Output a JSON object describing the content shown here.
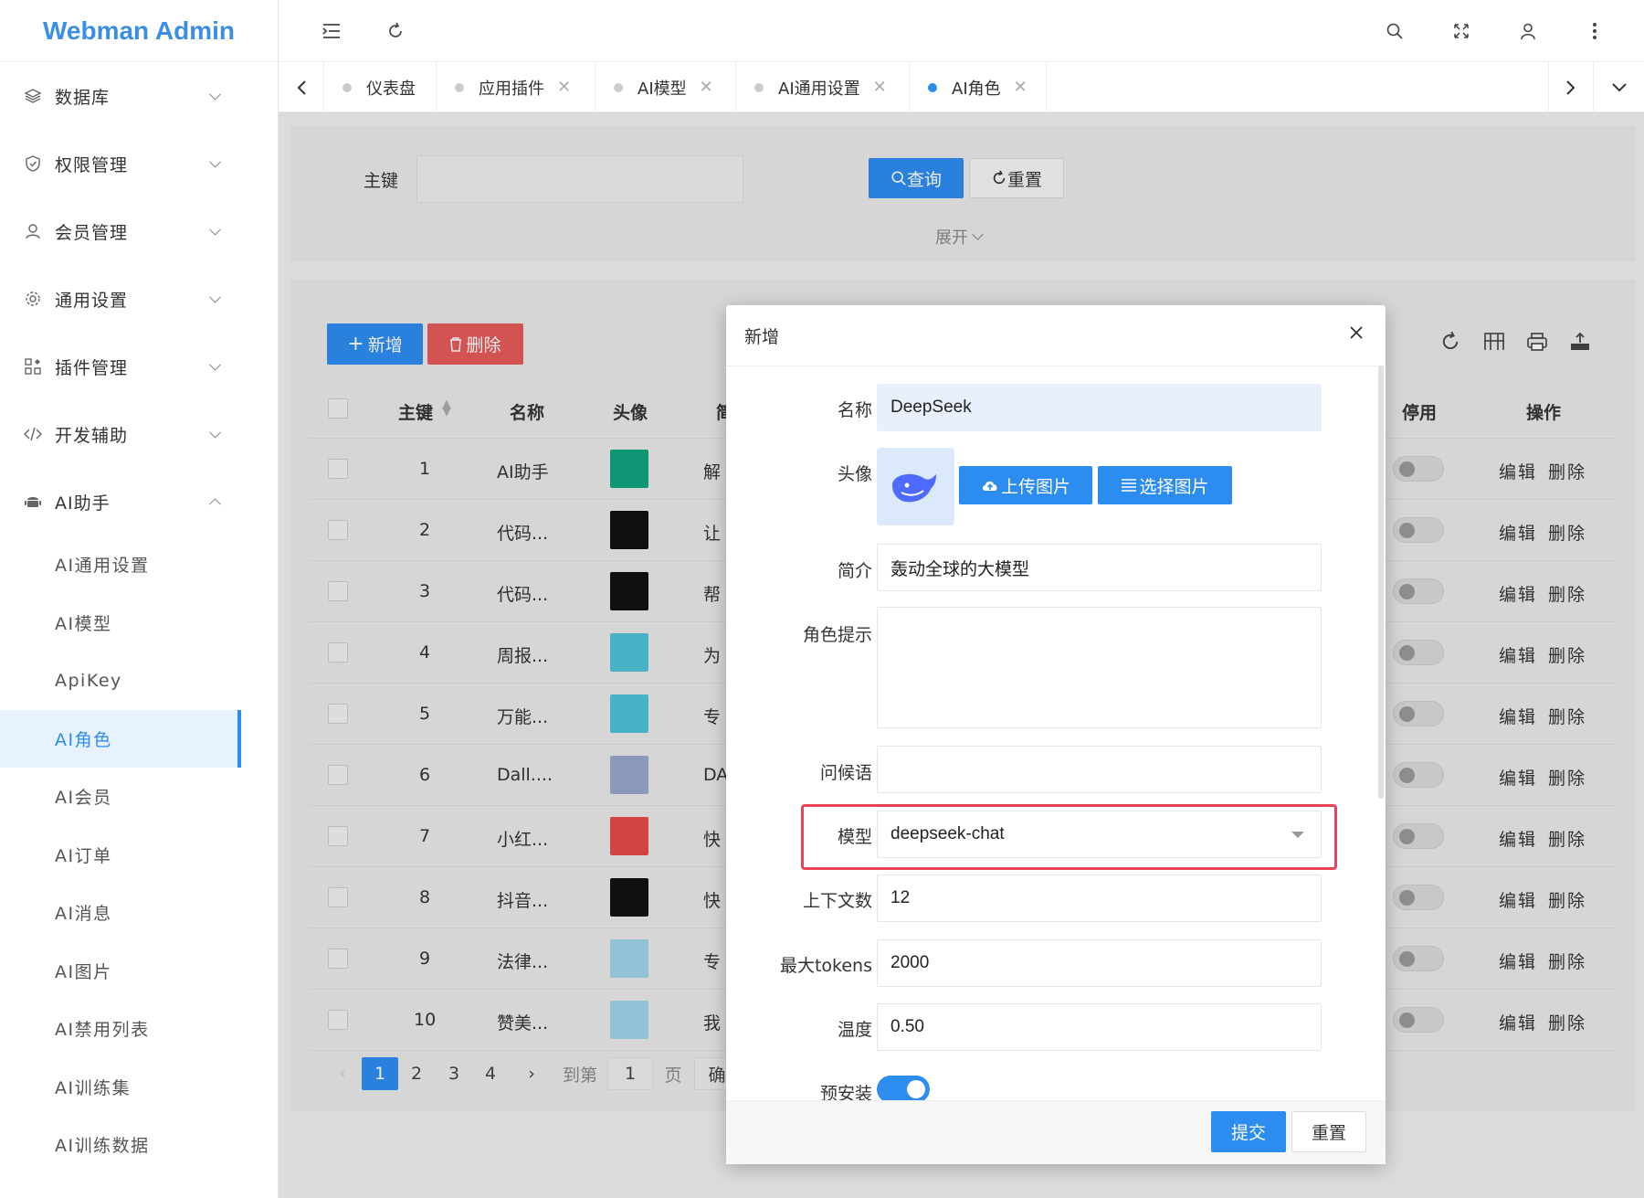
{
  "app": {
    "title": "Webman Admin"
  },
  "sidebar": {
    "groups": [
      {
        "label": "数据库",
        "icon": "layers-icon"
      },
      {
        "label": "权限管理",
        "icon": "shield-icon"
      },
      {
        "label": "会员管理",
        "icon": "user-icon"
      },
      {
        "label": "通用设置",
        "icon": "gear-icon"
      },
      {
        "label": "插件管理",
        "icon": "apps-icon"
      },
      {
        "label": "开发辅助",
        "icon": "code-icon"
      },
      {
        "label": "AI助手",
        "icon": "android-icon"
      }
    ],
    "subitems": [
      "AI通用设置",
      "AI模型",
      "ApiKey",
      "AI角色",
      "AI会员",
      "AI订单",
      "AI消息",
      "AI图片",
      "AI禁用列表",
      "AI训练集",
      "AI训练数据"
    ],
    "active": "AI角色"
  },
  "header": {
    "icons": [
      "menu-fold-icon",
      "refresh-icon",
      "search-icon",
      "fullscreen-icon",
      "user-icon",
      "more-icon"
    ]
  },
  "tabs": [
    {
      "label": "仪表盘",
      "closable": false
    },
    {
      "label": "应用插件",
      "closable": true
    },
    {
      "label": "AI模型",
      "closable": true
    },
    {
      "label": "AI通用设置",
      "closable": true
    },
    {
      "label": "AI角色",
      "closable": true,
      "active": true
    }
  ],
  "search": {
    "field_label": "主键",
    "field_value": "",
    "query_label": "查询",
    "reset_label": "重置",
    "expand_label": "展开"
  },
  "toolbar": {
    "add_label": "新增",
    "delete_label": "删除"
  },
  "table": {
    "columns": [
      "主键",
      "名称",
      "头像",
      "简",
      "停用",
      "操作"
    ],
    "rows": [
      {
        "id": "1",
        "name": "AI助手",
        "desc": "解",
        "avatar_color": "#10a37f",
        "avatar_icon": "openai-icon"
      },
      {
        "id": "2",
        "name": "代码...",
        "desc": "让",
        "avatar_color": "#111111",
        "avatar_icon": "terminal-icon"
      },
      {
        "id": "3",
        "name": "代码...",
        "desc": "帮",
        "avatar_color": "#111111",
        "avatar_icon": "code-icon"
      },
      {
        "id": "4",
        "name": "周报...",
        "desc": "为",
        "avatar_color": "#4fc3d8",
        "avatar_icon": "calendar-icon"
      },
      {
        "id": "5",
        "name": "万能...",
        "desc": "专",
        "avatar_color": "#4fc3d8",
        "avatar_icon": "translate-icon"
      },
      {
        "id": "6",
        "name": "Dall....",
        "desc": "DA",
        "avatar_color": "#9aa6c8",
        "avatar_icon": "palette-icon"
      },
      {
        "id": "7",
        "name": "小红...",
        "desc": "快",
        "avatar_color": "#e84a4a",
        "avatar_icon": "xiaohongshu-icon"
      },
      {
        "id": "8",
        "name": "抖音...",
        "desc": "快",
        "avatar_color": "#111111",
        "avatar_icon": "tiktok-icon"
      },
      {
        "id": "9",
        "name": "法律...",
        "desc": "专",
        "avatar_color": "#9fd3e8",
        "avatar_icon": "gavel-icon"
      },
      {
        "id": "10",
        "name": "赞美...",
        "desc": "我",
        "avatar_color": "#9fd3e8",
        "avatar_icon": "thumbs-up-icon"
      }
    ],
    "op_edit": "编辑",
    "op_delete": "删除"
  },
  "pager": {
    "pages": [
      "1",
      "2",
      "3",
      "4"
    ],
    "current": "1",
    "goto_label": "到第",
    "goto_value": "1",
    "page_unit": "页",
    "confirm": "确"
  },
  "modal": {
    "title": "新增",
    "fields": {
      "name": {
        "label": "名称",
        "value": "DeepSeek"
      },
      "avatar": {
        "label": "头像",
        "upload": "上传图片",
        "choose": "选择图片"
      },
      "intro": {
        "label": "简介",
        "value": "轰动全球的大模型"
      },
      "role_prompt": {
        "label": "角色提示",
        "value": ""
      },
      "greeting": {
        "label": "问候语",
        "value": ""
      },
      "model": {
        "label": "模型",
        "value": "deepseek-chat"
      },
      "context": {
        "label": "上下文数",
        "value": "12"
      },
      "max_tokens": {
        "label": "最大tokens",
        "value": "2000"
      },
      "temperature": {
        "label": "温度",
        "value": "0.50"
      },
      "preinstall": {
        "label": "预安装",
        "enabled": true
      }
    },
    "submit_label": "提交",
    "reset_label": "重置"
  },
  "colors": {
    "primary": "#2d8cf0",
    "danger": "#e55b5b",
    "highlight": "#e8415a"
  }
}
